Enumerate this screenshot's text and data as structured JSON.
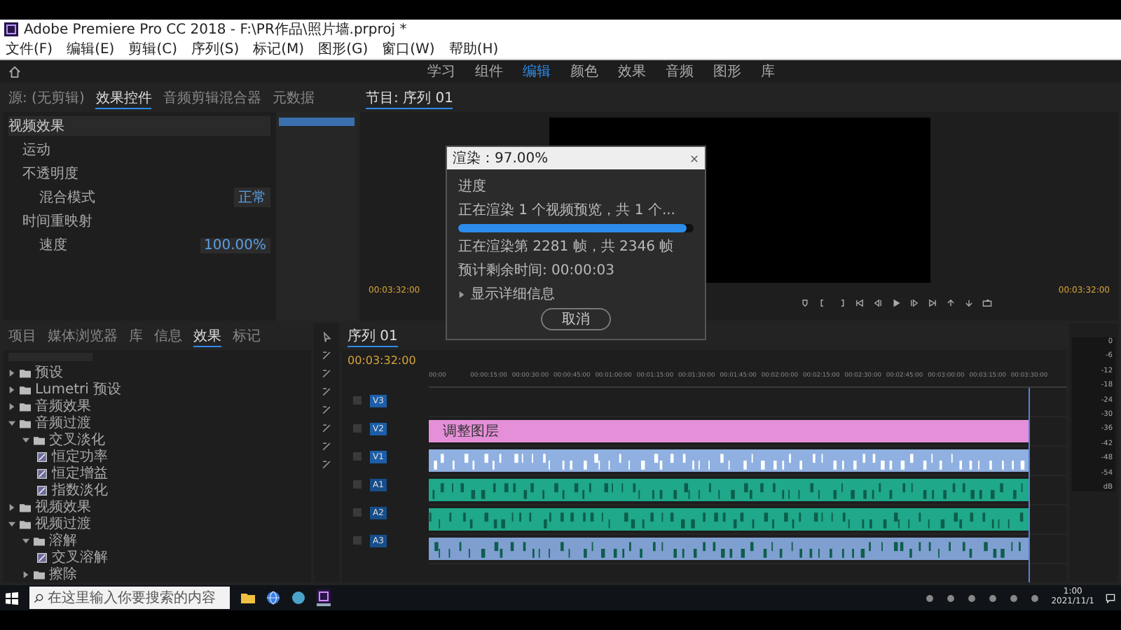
{
  "window": {
    "title": "Adobe Premiere Pro CC 2018 - F:\\PR作品\\照片墙.prproj *"
  },
  "menu": [
    "文件(F)",
    "编辑(E)",
    "剪辑(C)",
    "序列(S)",
    "标记(M)",
    "图形(G)",
    "窗口(W)",
    "帮助(H)"
  ],
  "workspaces": [
    {
      "label": "学习",
      "selected": false
    },
    {
      "label": "组件",
      "selected": false
    },
    {
      "label": "编辑",
      "selected": true
    },
    {
      "label": "颜色",
      "selected": false
    },
    {
      "label": "效果",
      "selected": false
    },
    {
      "label": "音频",
      "selected": false
    },
    {
      "label": "图形",
      "selected": false
    },
    {
      "label": "库",
      "selected": false
    }
  ],
  "effect_controls": {
    "tabs": [
      {
        "label": "源: (无剪辑)",
        "selected": false
      },
      {
        "label": "效果控件",
        "selected": true
      },
      {
        "label": "音频剪辑混合器",
        "selected": false
      },
      {
        "label": "元数据",
        "selected": false
      }
    ],
    "rows": [
      {
        "label": "视频效果",
        "kind": "section"
      },
      {
        "label": "运动",
        "kind": "effect"
      },
      {
        "label": "不透明度",
        "kind": "effect"
      },
      {
        "label": "混合模式",
        "kind": "property",
        "value": "正常"
      },
      {
        "label": "时间重映射",
        "kind": "effect"
      },
      {
        "label": "速度",
        "kind": "property",
        "value": "100.00%"
      }
    ]
  },
  "program": {
    "tab": "节目: 序列 01",
    "timecode_left": "00:03:32:00",
    "timecode_right": "00:03:32:00"
  },
  "render_dialog": {
    "title": "渲染：97.00%",
    "heading": "进度",
    "line1": "正在渲染 1 个视频预览，共 1 个...",
    "level": 0.97,
    "line2": "正在渲染第 2281 帧，共 2346 帧",
    "line3": "预计剩余时间: 00:00:03",
    "details": "显示详细信息",
    "cancel": "取消"
  },
  "project": {
    "tabs": [
      {
        "label": "项目",
        "selected": false
      },
      {
        "label": "媒体浏览器",
        "selected": false
      },
      {
        "label": "库",
        "selected": false
      },
      {
        "label": "信息",
        "selected": false
      },
      {
        "label": "效果",
        "selected": true
      },
      {
        "label": "标记",
        "selected": false
      }
    ],
    "tree": [
      {
        "label": "预设",
        "kind": "folder",
        "expanded": false
      },
      {
        "label": "Lumetri 预设",
        "kind": "folder",
        "expanded": false
      },
      {
        "label": "音频效果",
        "kind": "folder",
        "expanded": false
      },
      {
        "label": "音频过渡",
        "kind": "folder",
        "expanded": true,
        "children": [
          {
            "label": "交叉淡化",
            "kind": "folder",
            "expanded": true,
            "children": [
              {
                "label": "恒定功率",
                "kind": "item"
              },
              {
                "label": "恒定增益",
                "kind": "item"
              },
              {
                "label": "指数淡化",
                "kind": "item"
              }
            ]
          }
        ]
      },
      {
        "label": "视频效果",
        "kind": "folder",
        "expanded": false
      },
      {
        "label": "视频过渡",
        "kind": "folder",
        "expanded": true,
        "children": [
          {
            "label": "溶解",
            "kind": "folder",
            "expanded": true,
            "children": [
              {
                "label": "交叉溶解",
                "kind": "item"
              }
            ]
          },
          {
            "label": "擦除",
            "kind": "folder",
            "expanded": false
          }
        ]
      }
    ]
  },
  "timeline": {
    "tab": "序列 01",
    "timecode": "00:03:32:00",
    "ruler": [
      "00:00",
      "00:00:15:00",
      "00:00:30:00",
      "00:00:45:00",
      "00:01:00:00",
      "00:01:15:00",
      "00:01:30:00",
      "00:01:45:00",
      "00:02:00:00",
      "00:02:15:00",
      "00:02:30:00",
      "00:02:45:00",
      "00:03:00:00",
      "00:03:15:00",
      "00:03:30:00"
    ],
    "tracks": [
      {
        "name": "V3",
        "kind": "video"
      },
      {
        "name": "V2",
        "kind": "video",
        "color": "#e58fd8",
        "clip_label": "调整图层"
      },
      {
        "name": "V1",
        "kind": "video",
        "color": "#8fb0e0"
      },
      {
        "name": "A1",
        "kind": "audio",
        "color": "#1fa88a"
      },
      {
        "name": "A2",
        "kind": "audio",
        "color": "#1fa88a"
      },
      {
        "name": "A3",
        "kind": "audio",
        "color": "#7f9fd0"
      }
    ]
  },
  "meter": {
    "scale": [
      "0",
      "-6",
      "-12",
      "-18",
      "-24",
      "-30",
      "-36",
      "-42",
      "-48",
      "-54",
      "dB"
    ]
  },
  "taskbar": {
    "search_placeholder": "在这里输入你要搜索的内容",
    "time": "1:00",
    "date": "2021/11/1"
  }
}
